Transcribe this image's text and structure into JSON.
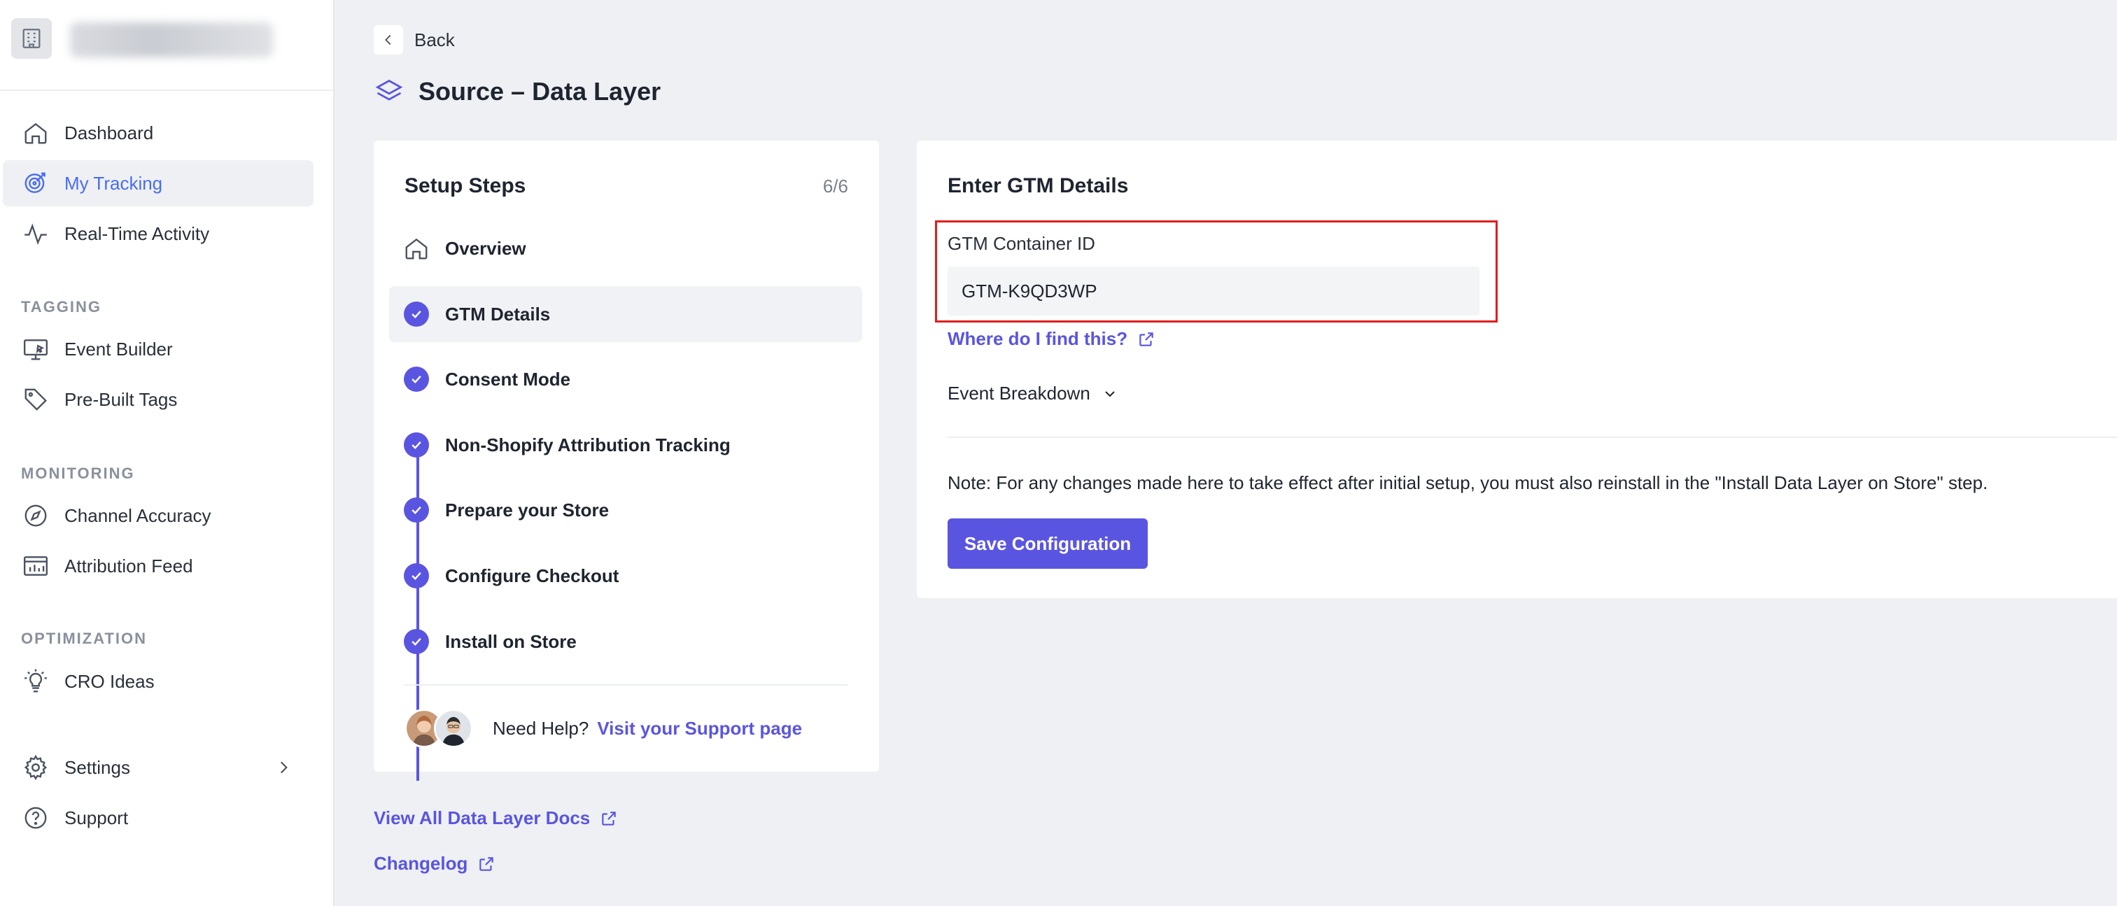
{
  "sidebar": {
    "brand_name": "",
    "items": {
      "dashboard": "Dashboard",
      "my_tracking": "My Tracking",
      "real_time": "Real-Time Activity",
      "event_builder": "Event Builder",
      "prebuilt_tags": "Pre-Built Tags",
      "channel_accuracy": "Channel Accuracy",
      "attribution_feed": "Attribution Feed",
      "cro_ideas": "CRO Ideas",
      "settings": "Settings",
      "support": "Support"
    },
    "sections": {
      "tagging": "TAGGING",
      "monitoring": "MONITORING",
      "optimization": "OPTIMIZATION"
    },
    "active_item": "My Tracking"
  },
  "header": {
    "back_label": "Back",
    "page_title": "Source – Data Layer"
  },
  "steps": {
    "title": "Setup Steps",
    "count": "6/6",
    "items": [
      {
        "label": "Overview",
        "completed": false,
        "active": false
      },
      {
        "label": "GTM Details",
        "completed": true,
        "active": true
      },
      {
        "label": "Consent Mode",
        "completed": true,
        "active": false
      },
      {
        "label": "Non-Shopify Attribution Tracking",
        "completed": true,
        "active": false
      },
      {
        "label": "Prepare your Store",
        "completed": true,
        "active": false
      },
      {
        "label": "Configure Checkout",
        "completed": true,
        "active": false
      },
      {
        "label": "Install on Store",
        "completed": true,
        "active": false
      }
    ],
    "help_label": "Need Help?",
    "support_link": "Visit your Support page"
  },
  "links": {
    "docs": "View All Data Layer Docs",
    "changelog": "Changelog"
  },
  "details": {
    "title": "Enter GTM Details",
    "container_label": "GTM Container ID",
    "container_value": "GTM-K9QD3WP",
    "find_link": "Where do I find this?",
    "breakdown": "Event Breakdown",
    "note": "Note: For any changes made here to take effect after initial setup, you must also reinstall in the \"Install Data Layer on Store\" step.",
    "save_button": "Save Configuration"
  },
  "colors": {
    "accent": "#5a55e0",
    "nav_active": "#4a6cf0",
    "highlight_border": "#e11d1d",
    "background": "#eef0f4"
  },
  "icons": [
    "building-icon",
    "home-icon",
    "target-icon",
    "activity-icon",
    "monitor-icon",
    "tag-icon",
    "compass-icon",
    "chart-feed-icon",
    "bulb-icon",
    "gear-icon",
    "help-icon",
    "chevron-left-icon",
    "layers-icon",
    "check-icon",
    "external-link-icon",
    "chevron-down-icon",
    "chevron-right-icon"
  ]
}
